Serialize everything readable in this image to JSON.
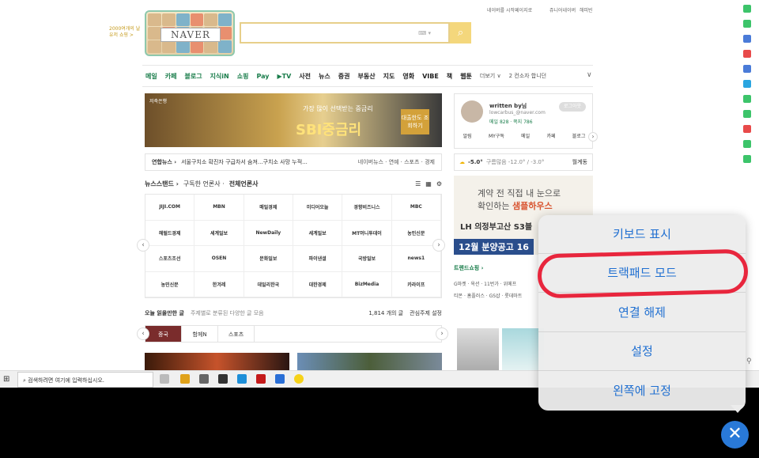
{
  "top_note": "2000여개의 날 유저 쇼핑 >",
  "top_links": {
    "start_page": "네이버를 시작페이지로",
    "shortcut": "쥬니어네이버",
    "happybean": "해피빈"
  },
  "logo_word": "NAVER",
  "search": {
    "value": "",
    "keyboard_label": "⌨ ▾"
  },
  "menu": {
    "items": [
      {
        "label": "메일",
        "cls": ""
      },
      {
        "label": "카페",
        "cls": ""
      },
      {
        "label": "블로그",
        "cls": ""
      },
      {
        "label": "지식iN",
        "cls": ""
      },
      {
        "label": "쇼핑",
        "cls": ""
      },
      {
        "label": "Pay",
        "cls": ""
      },
      {
        "label": "▶TV",
        "cls": ""
      },
      {
        "label": "사전",
        "cls": "dk"
      },
      {
        "label": "뉴스",
        "cls": "dk"
      },
      {
        "label": "증권",
        "cls": "dk"
      },
      {
        "label": "부동산",
        "cls": "dk"
      },
      {
        "label": "지도",
        "cls": "dk"
      },
      {
        "label": "영화",
        "cls": "dk"
      },
      {
        "label": "VIBE",
        "cls": "dk"
      },
      {
        "label": "책",
        "cls": "dk"
      },
      {
        "label": "웹툰",
        "cls": "dk"
      }
    ],
    "more": "더보기 ∨",
    "ticker": "2  컨소자 합니던"
  },
  "banner": {
    "tag": "저축은행",
    "sub": "가장 많이 선택받는 중금리",
    "main": "SBI중금리",
    "cta": "대출한도 조회하기"
  },
  "news_line": {
    "source": "연합뉴스 ›",
    "text": "서울구치소 확진자 구급차서 숨져...구치소 사망 누적...",
    "right": "네이버뉴스 · 연예 · 스포츠 · 경제"
  },
  "newsstand": {
    "title": "뉴스스탠드 ›",
    "subscribed": "구독한 언론사 ·",
    "all": "전체언론사"
  },
  "press": [
    "JIJI.COM",
    "MBN",
    "매일경제",
    "미디어오늘",
    "경향비즈니스",
    "MBC",
    "헤럴드경제",
    "세계일보",
    "NewDaily",
    "세계일보",
    "MT머니투데이",
    "농민신문",
    "스포츠조선",
    "OSEN",
    "문화일보",
    "파이낸셜",
    "국방일보",
    "news1",
    "농민신문",
    "한겨레",
    "데일리한국",
    "대한경제",
    "BizMedia",
    "카라이프"
  ],
  "read_head": {
    "title": "오늘 읽을만한 글",
    "sub": "주제별로 분류된 다양한 글 모음",
    "count": "1,814 개의 글",
    "setting": "관심주제 설정"
  },
  "tabs": [
    "중국",
    "함께N",
    "스포츠"
  ],
  "profile": {
    "name": "written by님",
    "email": "lowcarbus_@naver.com",
    "points": "메일 828 · 쪽지 786",
    "logout": "로그아웃",
    "shortcuts": [
      "알림",
      "MY구독",
      "메일",
      "카페",
      "블로그"
    ]
  },
  "weather": {
    "temp": "-5.0°",
    "desc": "구름많음 -12.0° / -3.0°",
    "area": "월계동"
  },
  "ad2": {
    "l1": "계약 전 직접 내 눈으로",
    "l2": "확인하는",
    "brand": "샘플하우스",
    "l3": "LH 의정부고산 S3블",
    "l4": "12월 분양공고 16"
  },
  "shop": {
    "title": "트렌드쇼핑 ›",
    "row1": "G마켓 · 옥션 · 11번가 · 위메프",
    "row2": "티몬 · 홈플러스 · GS샵 · 롯데마트"
  },
  "taskbar": {
    "start_icon": "windows-icon",
    "search_placeholder": "검색하려면 여기에 입력하십시오."
  },
  "popup": {
    "items": [
      "키보드 표시",
      "트랙패드 모드",
      "연결 해제",
      "설정",
      "왼쪽에 고정"
    ],
    "close": "✕"
  },
  "colors": {
    "naver_green": "#1a7d4b",
    "popup_text": "#1f6fd1",
    "annotation_red": "#e8263d",
    "close_blue": "#2979d8"
  }
}
